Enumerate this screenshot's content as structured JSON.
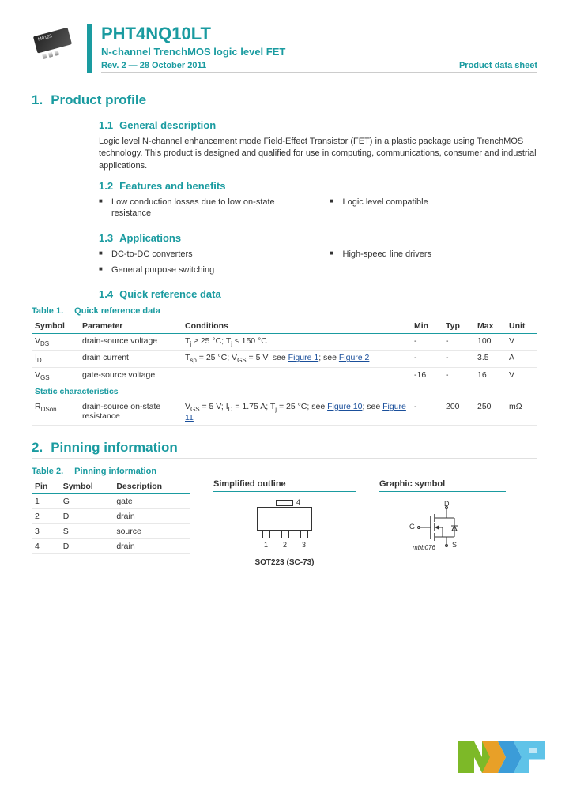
{
  "header": {
    "chipLabel": "M0123",
    "partNumber": "PHT4NQ10LT",
    "subtitle": "N-channel TrenchMOS logic level FET",
    "revision": "Rev. 2 — 28 October 2011",
    "docType": "Product data sheet"
  },
  "s1": {
    "num": "1.",
    "title": "Product profile",
    "s11": {
      "num": "1.1",
      "title": "General description",
      "text": "Logic level N-channel enhancement mode Field-Effect Transistor (FET) in a plastic package using TrenchMOS technology. This product is designed and qualified for use in computing, communications, consumer and industrial applications."
    },
    "s12": {
      "num": "1.2",
      "title": "Features and benefits",
      "left": [
        "Low conduction losses due to low on-state resistance"
      ],
      "right": [
        "Logic level compatible"
      ]
    },
    "s13": {
      "num": "1.3",
      "title": "Applications",
      "left": [
        "DC-to-DC converters",
        "General purpose switching"
      ],
      "right": [
        "High-speed line drivers"
      ]
    },
    "s14": {
      "num": "1.4",
      "title": "Quick reference data"
    }
  },
  "table1": {
    "caption": {
      "num": "Table 1.",
      "title": "Quick reference data"
    },
    "headers": [
      "Symbol",
      "Parameter",
      "Conditions",
      "Min",
      "Typ",
      "Max",
      "Unit"
    ],
    "rows": [
      {
        "sym": "V",
        "sub": "DS",
        "param": "drain-source voltage",
        "cond_pre": "T",
        "cond_sub1": "j",
        "cond_mid": " ≥ 25 °C; T",
        "cond_sub2": "j",
        "cond_post": " ≤ 150 °C",
        "min": "-",
        "typ": "-",
        "max": "100",
        "unit": "V"
      },
      {
        "sym": "I",
        "sub": "D",
        "param": "drain current",
        "cond_pre": "T",
        "cond_sub1": "sp",
        "cond_mid": " = 25 °C; V",
        "cond_sub2": "GS",
        "cond_post": " = 5 V; see ",
        "link1": "Figure 1",
        "cond_post2": "; see ",
        "link2": "Figure 2",
        "min": "-",
        "typ": "-",
        "max": "3.5",
        "unit": "A"
      },
      {
        "sym": "V",
        "sub": "GS",
        "param": "gate-source voltage",
        "cond": "",
        "min": "-16",
        "typ": "-",
        "max": "16",
        "unit": "V"
      }
    ],
    "sectionHeader": "Static characteristics",
    "row4": {
      "sym": "R",
      "sub": "DSon",
      "param": "drain-source on-state resistance",
      "cond_pre": "V",
      "cond_sub1": "GS",
      "cond_mid": " = 5 V; I",
      "cond_sub2": "D",
      "cond_post": " = 1.75 A; T",
      "cond_sub3": "j",
      "cond_post2": " = 25 °C; see ",
      "link1": "Figure 10",
      "cond_post3": "; see ",
      "link2": "Figure 11",
      "min": "-",
      "typ": "200",
      "max": "250",
      "unit": "mΩ"
    }
  },
  "s2": {
    "num": "2.",
    "title": "Pinning information"
  },
  "table2": {
    "caption": {
      "num": "Table 2.",
      "title": "Pinning information"
    },
    "headers": {
      "pin": "Pin",
      "sym": "Symbol",
      "desc": "Description",
      "outline": "Simplified outline",
      "graphic": "Graphic symbol"
    },
    "rows": [
      {
        "pin": "1",
        "sym": "G",
        "desc": "gate"
      },
      {
        "pin": "2",
        "sym": "D",
        "desc": "drain"
      },
      {
        "pin": "3",
        "sym": "S",
        "desc": "source"
      },
      {
        "pin": "4",
        "sym": "D",
        "desc": "drain"
      }
    ],
    "packageName": "SOT223 (SC-73)",
    "pinLabels": {
      "p1": "1",
      "p2": "2",
      "p3": "3",
      "p4": "4"
    },
    "mosLabels": {
      "d": "D",
      "g": "G",
      "s": "S",
      "ref": "mbb076"
    }
  }
}
